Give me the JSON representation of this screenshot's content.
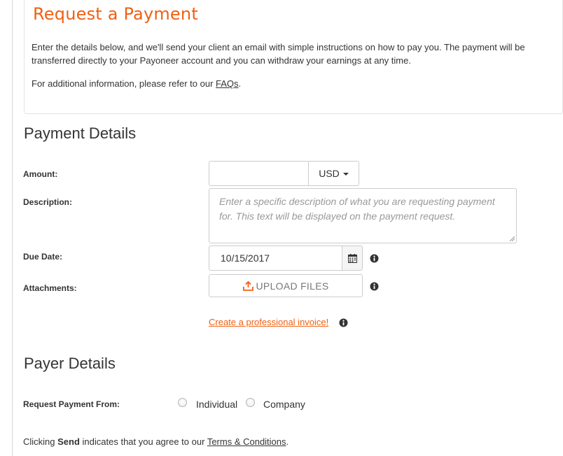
{
  "intro": {
    "title": "Request a Payment",
    "body": "Enter the details below, and we'll send your client an email with simple instructions on how to pay you. The payment will be transferred directly to your Payoneer account and you can withdraw your earnings at any time.",
    "more_prefix": "For additional information, please refer to our ",
    "faq_link": "FAQs",
    "more_suffix": "."
  },
  "payment_details": {
    "title": "Payment Details",
    "amount_label": "Amount:",
    "amount_value": "",
    "currency": "USD",
    "description_label": "Description:",
    "description_placeholder": "Enter a specific description of what you are requesting payment for. This text will be displayed on the payment request.",
    "due_date_label": "Due Date:",
    "due_date_value": "10/15/2017",
    "attachments_label": "Attachments:",
    "upload_label": "UPLOAD FILES",
    "invoice_link": "Create a professional invoice!"
  },
  "payer_details": {
    "title": "Payer Details",
    "request_from_label": "Request Payment From:",
    "options": [
      "Individual",
      "Company"
    ]
  },
  "consent": {
    "prefix": "Clicking ",
    "bold": "Send",
    "middle": " indicates that you agree to our ",
    "terms_link": "Terms & Conditions",
    "suffix": "."
  },
  "colors": {
    "accent": "#f06012",
    "text": "#333333",
    "border": "#cccccc",
    "placeholder": "#999999"
  },
  "icons": [
    "calendar-icon",
    "upload-icon",
    "info-icon",
    "caret-down-icon"
  ]
}
